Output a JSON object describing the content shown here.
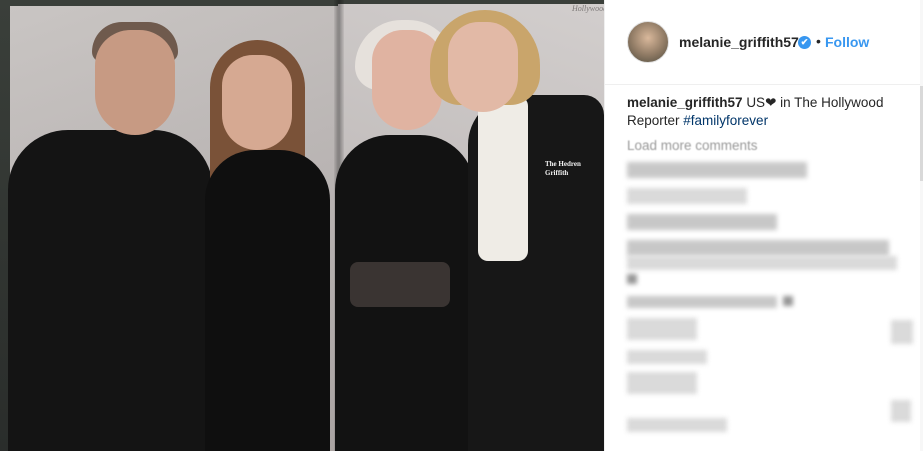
{
  "post": {
    "username": "melanie_griffith57",
    "verified_symbol": "✔",
    "separator": "•",
    "follow_label": "Follow",
    "photo_watermark": "Hollywood",
    "photo_caption_text": "The Hedren Griffith"
  },
  "caption": {
    "user": "melanie_griffith57",
    "text_before_heart": "US",
    "heart": "❤",
    "text_after_heart": " in The Hollywood Reporter ",
    "hashtag": "#familyforever"
  },
  "comments": {
    "load_more_label": "Load more comments"
  },
  "colors": {
    "accent": "#3897f0",
    "text": "#262626",
    "hashtag": "#003569",
    "muted": "#999999",
    "border": "#efefef"
  },
  "icons": {
    "verified": "verified-badge-icon"
  }
}
